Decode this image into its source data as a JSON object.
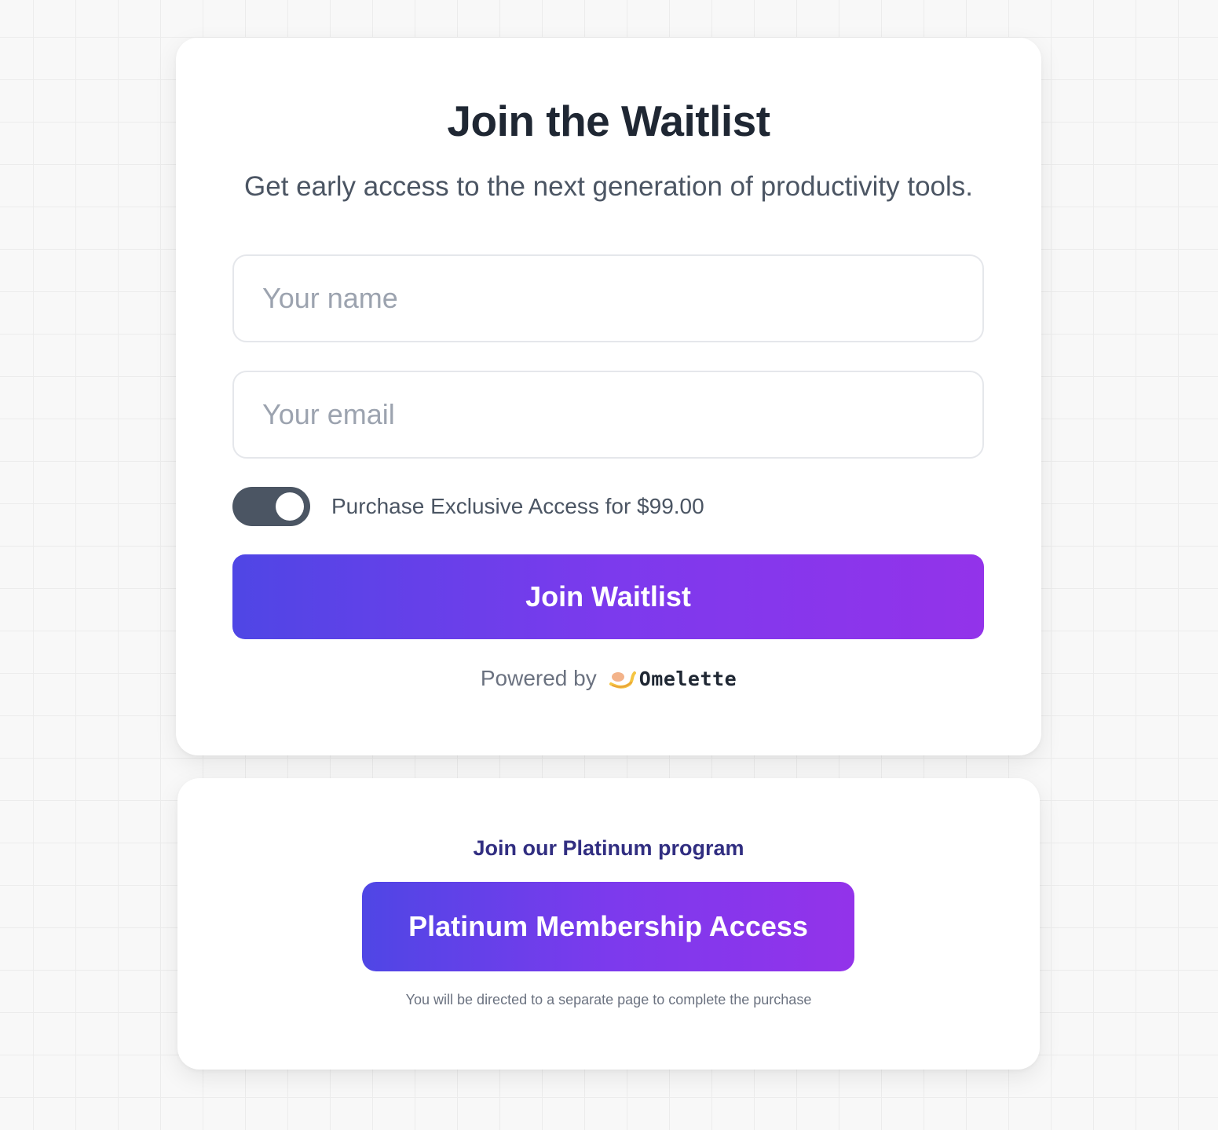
{
  "waitlist": {
    "title": "Join the Waitlist",
    "subtitle": "Get early access to the next generation of productivity tools.",
    "name_input": {
      "placeholder": "Your name",
      "value": ""
    },
    "email_input": {
      "placeholder": "Your email",
      "value": ""
    },
    "exclusive_toggle": {
      "label": "Purchase Exclusive Access for $99.00",
      "on": true
    },
    "submit_label": "Join Waitlist",
    "powered_by": {
      "text": "Powered by",
      "brand": "Omelette"
    }
  },
  "platinum": {
    "heading": "Join our Platinum program",
    "button_label": "Platinum Membership Access",
    "note": "You will be directed to a separate page to complete the purchase"
  },
  "colors": {
    "gradient_start": "#4f46e5",
    "gradient_end": "#9333ea",
    "toggle_on": "#4b5563",
    "heading": "#1f2733",
    "platinum_heading": "#312e81"
  },
  "icons": {
    "brand_logo": "omelette-logo-icon"
  }
}
